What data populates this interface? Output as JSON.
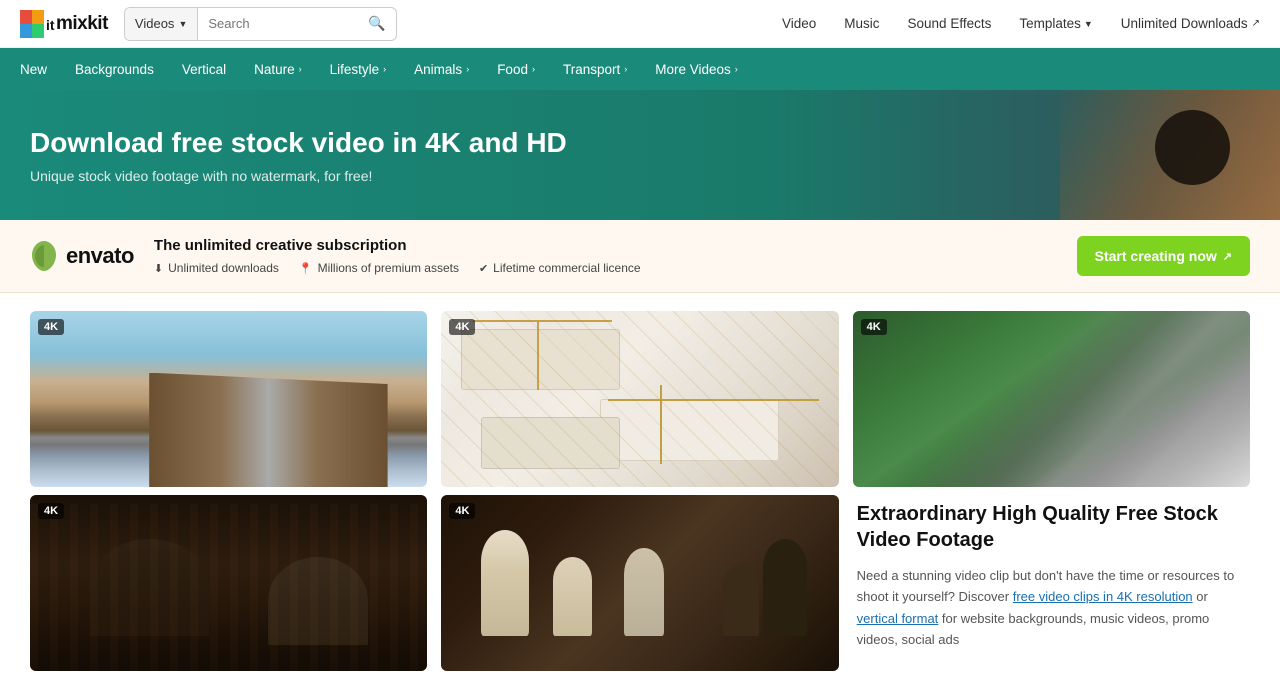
{
  "header": {
    "logo_text": "mixkit",
    "search_placeholder": "Search",
    "videos_btn": "Videos",
    "nav_items": [
      {
        "label": "Video",
        "href": "#"
      },
      {
        "label": "Music",
        "href": "#"
      },
      {
        "label": "Sound Effects",
        "href": "#"
      },
      {
        "label": "Templates",
        "href": "#",
        "has_chevron": true
      },
      {
        "label": "Unlimited Downloads",
        "href": "#",
        "external": true
      }
    ]
  },
  "subnav": {
    "items": [
      {
        "label": "New",
        "has_chevron": false
      },
      {
        "label": "Backgrounds",
        "has_chevron": false
      },
      {
        "label": "Vertical",
        "has_chevron": false
      },
      {
        "label": "Nature",
        "has_chevron": true
      },
      {
        "label": "Lifestyle",
        "has_chevron": true
      },
      {
        "label": "Animals",
        "has_chevron": true
      },
      {
        "label": "Food",
        "has_chevron": true
      },
      {
        "label": "Transport",
        "has_chevron": true
      },
      {
        "label": "More Videos",
        "has_chevron": true
      }
    ]
  },
  "hero": {
    "title": "Download free stock video in 4K and HD",
    "subtitle": "Unique stock video footage with no watermark, for free!"
  },
  "envato": {
    "tagline": "The unlimited creative subscription",
    "features": [
      {
        "icon": "download",
        "text": "Unlimited downloads"
      },
      {
        "icon": "location",
        "text": "Millions of premium assets"
      },
      {
        "icon": "shield",
        "text": "Lifetime commercial licence"
      }
    ],
    "cta": "Start creating now"
  },
  "videos": {
    "row1": [
      {
        "badge": "4K",
        "alt": "Aerial road over water"
      },
      {
        "badge": "4K",
        "alt": "Gift boxes with ribbons"
      },
      {
        "badge": "4K",
        "alt": "Aerial road through forest"
      }
    ],
    "row2": [
      {
        "badge": "4K",
        "alt": "Interview in library"
      },
      {
        "badge": "4K",
        "alt": "Chess pieces"
      }
    ],
    "text_card": {
      "title": "Extraordinary High Quality Free Stock Video Footage",
      "body": "Need a stunning video clip but don't have the time or resources to shoot it yourself? Discover ",
      "link1": "free video clips in 4K resolution",
      "mid": " or ",
      "link2": "vertical format",
      "tail": " for website backgrounds, music videos, promo videos, social ads"
    }
  }
}
